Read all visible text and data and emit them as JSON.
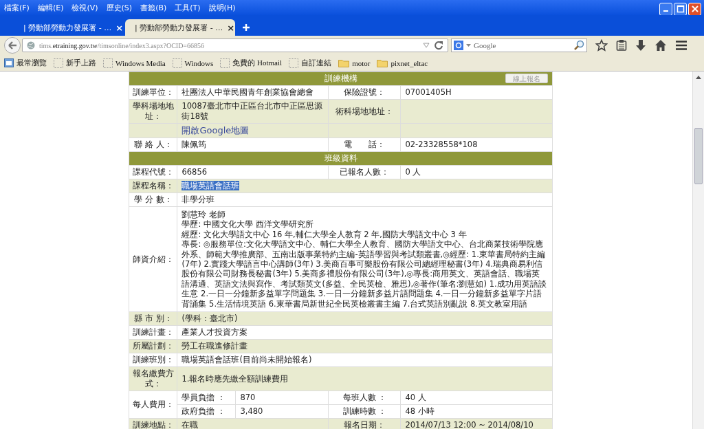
{
  "menu": [
    "檔案(F)",
    "編輯(E)",
    "檢視(V)",
    "歷史(S)",
    "書籤(B)",
    "工具(T)",
    "說明(H)"
  ],
  "tabs": [
    {
      "title": "| 勞動部勞動力發展署 - …",
      "close": "×",
      "selected": false
    },
    {
      "title": "| 勞動部勞動力發展署 - …",
      "close": "×",
      "selected": true
    }
  ],
  "url": {
    "prefix": "tims.",
    "domain": "etraining.gov.tw",
    "path": "/timsonline/index3.aspx?OCID=66856"
  },
  "search": {
    "placeholder": "Google"
  },
  "bookmarks": [
    {
      "label": "最常瀏覽",
      "kind": "smart"
    },
    {
      "label": "新手上路",
      "kind": "page"
    },
    {
      "label": "Windows Media",
      "kind": "page"
    },
    {
      "label": "Windows",
      "kind": "page"
    },
    {
      "label": "免費的 Hotmail",
      "kind": "page"
    },
    {
      "label": "自訂連結",
      "kind": "page"
    },
    {
      "label": "motor",
      "kind": "folder"
    },
    {
      "label": "pixnet_eltac",
      "kind": "folder"
    }
  ],
  "sections": [
    {
      "heading": "訓練機構",
      "button": "線上報名",
      "rows": [
        {
          "kind": "pair",
          "shaded": false,
          "label": "訓練單位：",
          "value": "社團法人中華民國青年創業協會總會",
          "label2": "保險證號：",
          "value2": "07001405H"
        },
        {
          "kind": "pair",
          "shaded": true,
          "label": "學科場地地址：",
          "value": "10087臺北市中正區台北市中正區思源街18號",
          "label2": "術科場地地址："
        },
        {
          "kind": "link",
          "shaded": true,
          "link": "開啟Google地圖"
        },
        {
          "kind": "pair",
          "shaded": false,
          "label": "聯 絡 人：",
          "value": "陳佩筠",
          "label2": "電　　話：",
          "value2": "02-23328558*108"
        }
      ]
    },
    {
      "heading": "班級資料",
      "rows": [
        {
          "kind": "pair",
          "shaded": false,
          "label": "課程代號：",
          "value": "66856",
          "label2": "已報名人數：",
          "value2": "0 人"
        },
        {
          "kind": "full",
          "shaded": true,
          "label": "課程名稱：",
          "value": "職場英語會話班",
          "highlighted": true
        },
        {
          "kind": "full",
          "shaded": false,
          "label": "學 分 數：",
          "value": "非學分班"
        },
        {
          "kind": "lines",
          "shaded": false,
          "label": "師資介紹：",
          "lines": [
            "劉慧玲 老師",
            "學歷: 中國文化大學 西洋文學研究所",
            "經歷: 文化大學語文中心 16 年,輔仁大學全人教育 2 年,國防大學語文中心 3 年",
            "專長: ◎服務單位:文化大學語文中心、輔仁大學全人教育、國防大學語文中心、台北商業技術學院應外系、師範大學推廣部、五南出版事業特約主編-英語學習與考試類叢書,◎經歷: 1.東華書局特約主編(7年) 2.實踐大學語言中心講師(3年) 3.美商百事可樂股份有限公司總經理秘書(3年) 4.瑞典商易利信股份有限公司財務長秘書(3年) 5.美商多禮股份有限公司(3年),◎專長:商用英文、英語會話、職場英語溝通、英語文法與寫作、考試類英文(多益、全民英檢、雅思),◎著作(筆名:劉慧如) 1.成功用英語談生意 2.一日一分鐘新多益單字問題集 3.一日一分鐘新多益片語問題集 4.一日一分鐘新多益單字片語背誦集 5.生活情境英語 6.東華書局新世紀全民英檢叢書主編 7.台式英語別亂說 8.英文教室用語"
          ]
        },
        {
          "kind": "full",
          "shaded": true,
          "label": "縣 市 別：",
          "value": "(學科：臺北市)"
        },
        {
          "kind": "full",
          "shaded": false,
          "label": "訓練計畫：",
          "value": "產業人才投資方案"
        },
        {
          "kind": "full",
          "shaded": true,
          "label": "所屬計劃：",
          "value": "勞工在職進修計畫"
        },
        {
          "kind": "full",
          "shaded": false,
          "label": "訓練班別：",
          "value": "職場英語會話班(目前尚未開始報名)"
        },
        {
          "kind": "full",
          "shaded": true,
          "label": "報名繳費方式：",
          "value": "1.報名時應先繳全額訓練費用"
        },
        {
          "kind": "cost",
          "shaded": false,
          "label": "每人費用：",
          "items": [
            [
              "學員負擔 ：",
              "870",
              "每班人數 ：",
              "40 人"
            ],
            [
              "政府負擔 ：",
              "3,480",
              "訓練時數 ：",
              "48 小時"
            ]
          ]
        },
        {
          "kind": "pair",
          "shaded": true,
          "label": "訓練地點：",
          "value": "在職",
          "label2": "報名日期：",
          "value2": "2014/07/13 12:00 ~  2014/08/10"
        }
      ]
    }
  ]
}
